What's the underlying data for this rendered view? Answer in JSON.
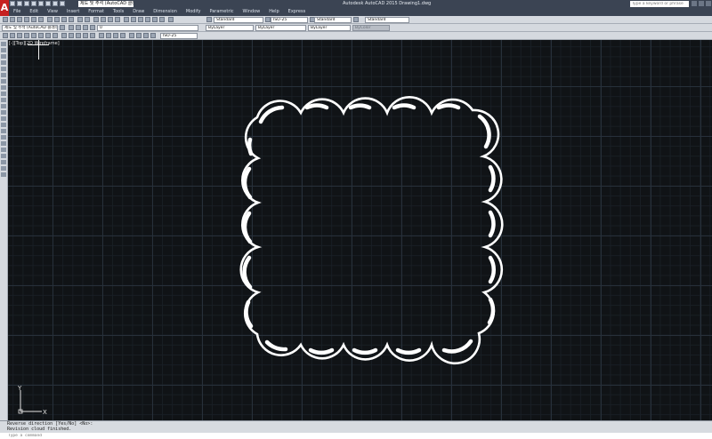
{
  "title_bar": {
    "workspace": "제도 및 주석 (AutoCAD 클래식)",
    "window_title": "Autodesk AutoCAD 2015    Drawing1.dwg",
    "search_placeholder": "Type a keyword or phrase"
  },
  "menu": [
    "File",
    "Edit",
    "View",
    "Insert",
    "Format",
    "Tools",
    "Draw",
    "Dimension",
    "Modify",
    "Parametric",
    "Window",
    "Help",
    "Express"
  ],
  "styles_toolbar": {
    "text_style": "Standard",
    "dim_style": "ISO-25",
    "table_style": "Standard",
    "mleader_style": "Standard"
  },
  "layers_toolbar": {
    "workspace": "제도 및 주석 (AutoCAD 클래식)",
    "layer": "0",
    "color": "ByLayer",
    "linetype": "ByLayer",
    "lineweight": "ByLayer",
    "plotstyle": "ByColor"
  },
  "dim_toolbar": {
    "dim_style": "ISO-25"
  },
  "viewport": {
    "label": "[-][Top][2D Wireframe]",
    "ucs_x": "X",
    "ucs_y": "Y"
  },
  "command_line": {
    "history": [
      "Reverse direction [Yes/No] <No>:",
      "Revision cloud finished."
    ],
    "placeholder": "Type a command"
  },
  "colors": {
    "canvas": "#101316",
    "cloud": "#ffffff",
    "chrome": "#3b4453",
    "accent": "#c62020"
  }
}
